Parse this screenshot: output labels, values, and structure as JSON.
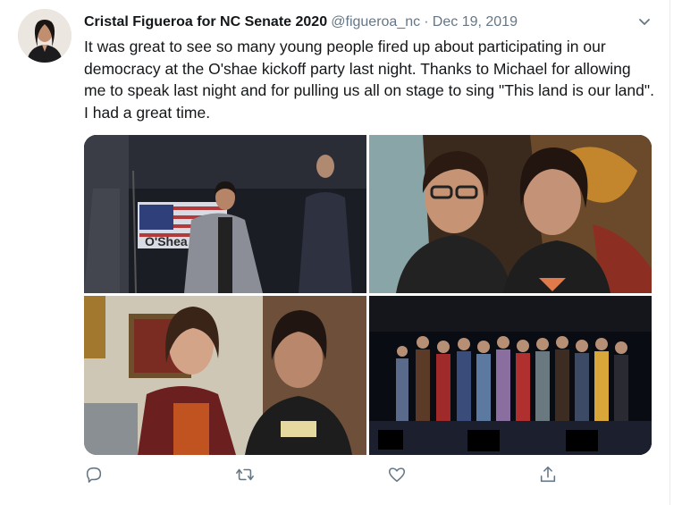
{
  "tweet": {
    "author_name": "Cristal Figueroa for NC Senate 2020",
    "handle": "@figueroa_nc",
    "separator": "·",
    "date": "Dec 19, 2019",
    "text": "It was great to see so many young people fired up about participating in our democracy at the O'shae kickoff party last night. Thanks to Michael for allowing me to speak last night and for pulling us all on stage to sing \"This land is our land\". I had a great time.",
    "photo1_sign": "O'Shea"
  },
  "icons": {
    "avatar": "profile-photo",
    "caret": "chevron-down-icon",
    "reply": "reply-icon",
    "retweet": "retweet-icon",
    "like": "heart-icon",
    "share": "share-icon"
  },
  "colors": {
    "text": "#14171a",
    "muted": "#657786",
    "icon": "#657786",
    "border": "#e6ecf0"
  }
}
